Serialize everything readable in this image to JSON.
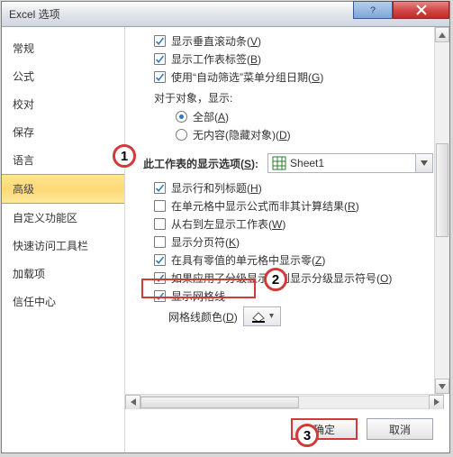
{
  "window": {
    "title": "Excel 选项"
  },
  "sidebar": {
    "items": [
      {
        "label": "常规"
      },
      {
        "label": "公式"
      },
      {
        "label": "校对"
      },
      {
        "label": "保存"
      },
      {
        "label": "语言"
      },
      {
        "label": "高级",
        "selected": true
      },
      {
        "label": "自定义功能区"
      },
      {
        "label": "快速访问工具栏"
      },
      {
        "label": "加载项"
      },
      {
        "label": "信任中心"
      }
    ]
  },
  "main": {
    "options_top": [
      {
        "kind": "chk",
        "checked": true,
        "label": "显示垂直滚动条",
        "accel": "V"
      },
      {
        "kind": "chk",
        "checked": true,
        "label": "显示工作表标签",
        "accel": "B"
      },
      {
        "kind": "chk",
        "checked": true,
        "label": "使用“自动筛选”菜单分组日期",
        "accel": "G"
      }
    ],
    "objects_label": "对于对象，显示:",
    "objects_options": [
      {
        "kind": "rad",
        "checked": true,
        "label": "全部",
        "accel": "A"
      },
      {
        "kind": "rad",
        "checked": false,
        "label": "无内容(隐藏对象)",
        "accel": "D"
      }
    ],
    "section_header": {
      "label": "此工作表的显示选项",
      "accel": "S",
      "sheet": "Sheet1"
    },
    "options_sheet": [
      {
        "kind": "chk",
        "checked": true,
        "label": "显示行和列标题",
        "accel": "H"
      },
      {
        "kind": "chk",
        "checked": false,
        "label": "在单元格中显示公式而非其计算结果",
        "accel": "R"
      },
      {
        "kind": "chk",
        "checked": false,
        "label": "从右到左显示工作表",
        "accel": "W"
      },
      {
        "kind": "chk",
        "checked": false,
        "label": "显示分页符",
        "accel": "K"
      },
      {
        "kind": "chk",
        "checked": true,
        "label": "在具有零值的单元格中显示零",
        "accel": "Z"
      },
      {
        "kind": "chk",
        "checked": true,
        "label": "如果应用了分级显示，则显示分级显示符号",
        "accel": "O"
      },
      {
        "kind": "chk",
        "checked": true,
        "label": "显示网格线"
      }
    ],
    "gridline_color_label": "网格线颜色",
    "gridline_color_accel": "D"
  },
  "footer": {
    "ok": "确定",
    "cancel": "取消"
  },
  "annotations": {
    "n1": "1",
    "n2": "2",
    "n3": "3"
  }
}
